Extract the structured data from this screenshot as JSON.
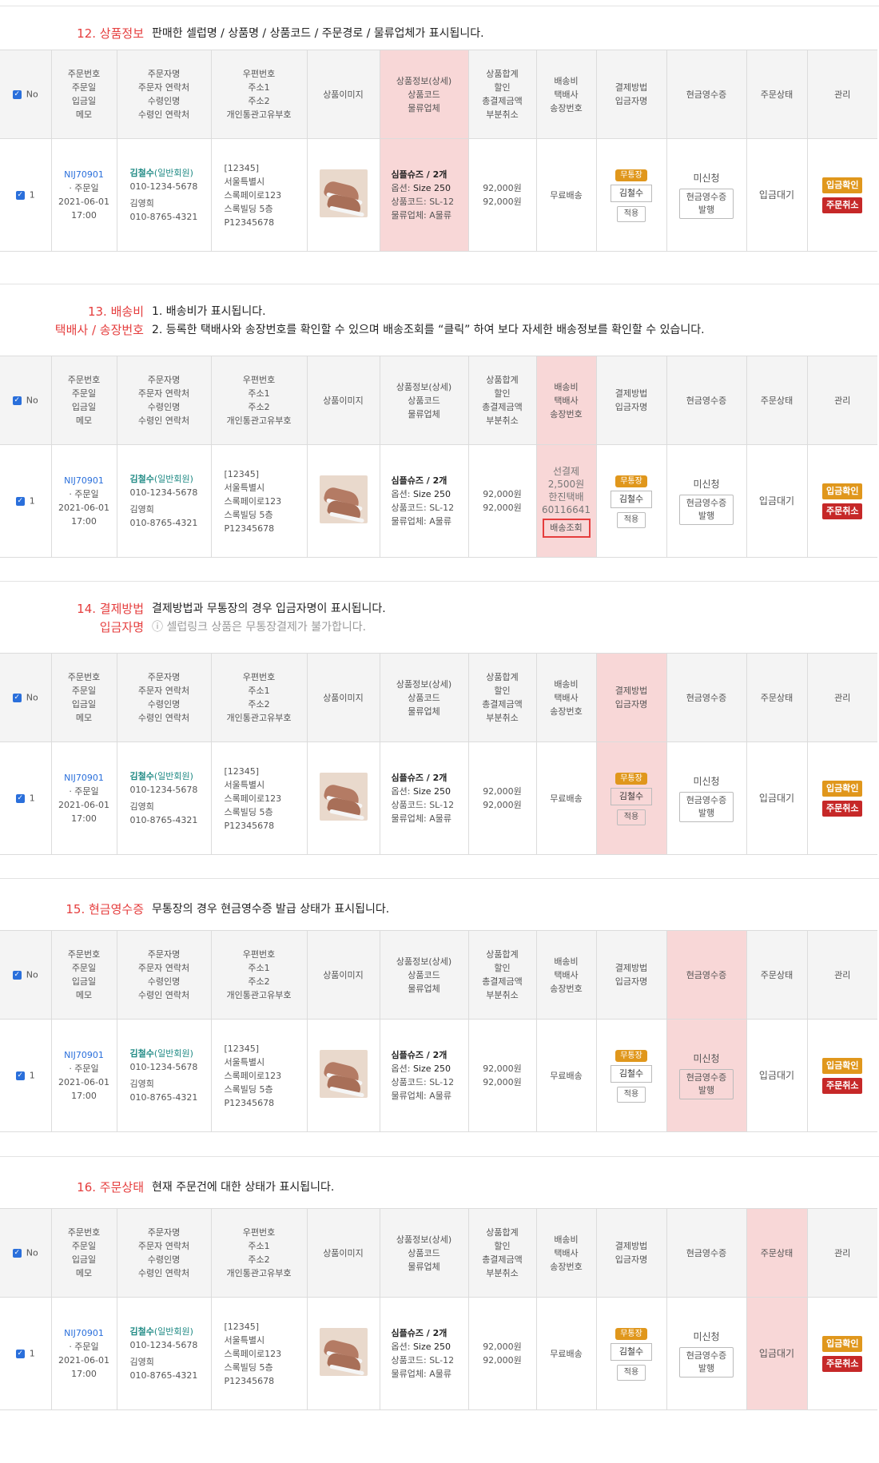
{
  "header_columns": {
    "no": "No",
    "order": [
      "주문번호",
      "주문일",
      "입금일",
      "메모"
    ],
    "orderer": [
      "주문자명",
      "주문자 연락처",
      "수령인명",
      "수령인 연락처"
    ],
    "address": [
      "우편번호",
      "주소1",
      "주소2",
      "개인통관고유부호"
    ],
    "image": "상품이미지",
    "product": [
      "상품정보(상세)",
      "상품코드",
      "물류업체"
    ],
    "total": [
      "상품합계",
      "할인",
      "총결제금액",
      "부분취소"
    ],
    "shipping": [
      "배송비",
      "택배사",
      "송장번호"
    ],
    "payment": [
      "결제방법",
      "입금자명"
    ],
    "receipt": "현금영수증",
    "status": "주문상태",
    "manage": "관리"
  },
  "row": {
    "no": "1",
    "order_no": "NIJ70901",
    "order_date_label": "· 주문일",
    "order_date": "2021-06-01",
    "order_time": "17:00",
    "buyer_name": "김철수",
    "buyer_type": "(일반회원)",
    "buyer_phone": "010-1234-5678",
    "recipient": "김영희",
    "recipient_phone": "010-8765-4321",
    "zip": "[12345]",
    "addr1": "서울특별시",
    "addr2": "스록페이로123",
    "addr3": "스록빌딩 5층",
    "customs": "P12345678",
    "product_name": "심플슈즈 / 2개",
    "option_label": "옵션: ",
    "option_value": "Size 250",
    "code_label": "상품코드: ",
    "code_value": "SL-12",
    "logistics_label": "물류업체: ",
    "logistics_value": "A물류",
    "total1": "92,000원",
    "total2": "92,000원",
    "shipping_free": "무료배송",
    "ship_prepaid": "선결제",
    "ship_fee": "2,500원",
    "courier": "한진택배",
    "tracking_no": "60116641",
    "track_btn": "배송조회",
    "pay_badge": "무통장",
    "depositor": "김철수",
    "apply_btn": "적용",
    "receipt_status": "미신청",
    "receipt_btn_1": "현금영수증",
    "receipt_btn_2": "발행",
    "order_status": "입금대기",
    "confirm_btn": "입금확인",
    "cancel_btn": "주문취소"
  },
  "sections": {
    "s12": {
      "title": "12. 상품정보",
      "desc": "판매한 셀럽명 / 상품명 / 상품코드 / 주문경로 / 물류업체가 표시됩니다."
    },
    "s13": {
      "title": "13. 배송비",
      "title2": "택배사 / 송장번호",
      "desc1": "1. 배송비가 표시됩니다.",
      "desc2": "2. 등록한 택배사와 송장번호를 확인할 수 있으며 배송조회를 “클릭” 하여 보다 자세한 배송정보를 확인할 수 있습니다."
    },
    "s14": {
      "title": "14. 결제방법",
      "title2": "입금자명",
      "desc": "결제방법과 무통장의 경우 입금자명이 표시됩니다.",
      "note": "ⓘ 셀럽링크 상품은 무통장결제가 불가합니다."
    },
    "s15": {
      "title": "15. 현금영수증",
      "desc": "무통장의 경우 현금영수증 발급 상태가 표시됩니다."
    },
    "s16": {
      "title": "16. 주문상태",
      "desc": "현재 주문건에 대한 상태가 표시됩니다."
    }
  },
  "colors": {
    "accent": "#e53d3d",
    "highlight": "#f8d7d7",
    "link": "#2a6fdb",
    "buyer": "#1f8a84",
    "pay_badge": "#e0971c",
    "cancel": "#c62828"
  }
}
